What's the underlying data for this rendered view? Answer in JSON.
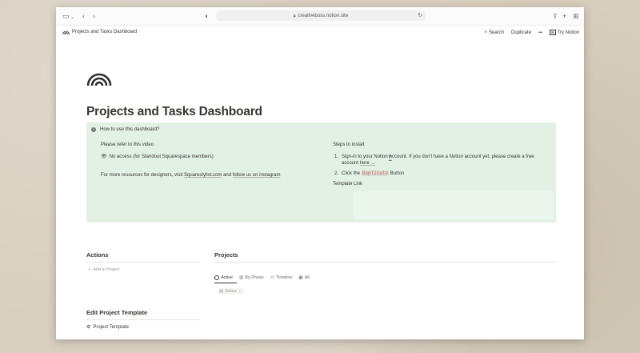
{
  "browser": {
    "url": "creativeboss.notion.site"
  },
  "topbar": {
    "page_name": "Projects and Tasks Dashboard",
    "search_label": "Search",
    "duplicate_label": "Duplicate",
    "more_label": "•••",
    "try_label": "Try Notion"
  },
  "page": {
    "title": "Projects and Tasks Dashboard"
  },
  "callout": {
    "heading": "How to use this dashboard?",
    "left": {
      "refer": "Please refer to this video",
      "no_access": "No access (for Standout Squarespace members)",
      "resources_prefix": "For more resources for designers, visit ",
      "resources_link": "Squarestylist.com",
      "resources_mid": " and ",
      "resources_link2": "follow us on instagram"
    },
    "right": {
      "steps_title": "Steps to install:",
      "step1_num": "1.",
      "step1_text": "Sign-in to your Notion Account. If you don't have a Notion account yet, please create a free account ",
      "step1_link": "here →",
      "step2_num": "2.",
      "step2_prefix": "Click the ",
      "step2_code": "Duplicate",
      "step2_suffix": " Button",
      "template_link": "Template Link"
    }
  },
  "actions": {
    "heading": "Actions",
    "add_project": "Add a Project"
  },
  "projects": {
    "heading": "Projects",
    "tabs": [
      "Active",
      "By Phase",
      "Timeline",
      "All"
    ],
    "filter": "Dates"
  },
  "edit_template": {
    "heading": "Edit Project Template",
    "item": "Project Template"
  }
}
